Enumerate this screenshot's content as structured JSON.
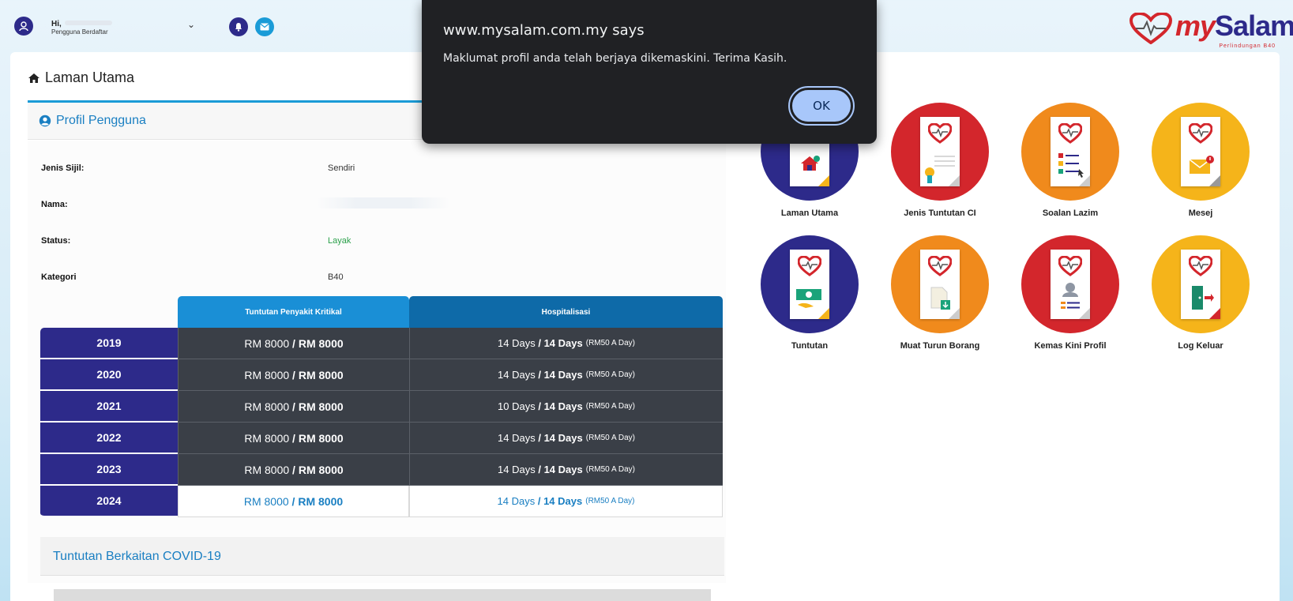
{
  "header": {
    "greeting": "Hi,",
    "user_role": "Pengguna Berdaftar",
    "logo": {
      "my": "my",
      "salam": "Salam",
      "tagline": "Perlindungan B40"
    }
  },
  "page_title": "Laman Utama",
  "profile": {
    "section_title": "Profil Pengguna",
    "fields": [
      {
        "label": "Jenis Sijil:",
        "value": "Sendiri"
      },
      {
        "label": "Nama:",
        "value": ""
      },
      {
        "label": "Status:",
        "value": "Layak"
      },
      {
        "label": "Kategori",
        "value": "B40"
      }
    ]
  },
  "claims_table": {
    "headers": {
      "ci": "Tuntutan Penyakit Kritikal",
      "hosp": "Hospitalisasi"
    },
    "rows": [
      {
        "year": "2019",
        "ci_used": "RM 8000",
        "ci_limit": "RM 8000",
        "hosp_used": "14 Days",
        "hosp_limit": "14 Days",
        "hosp_rate": "(RM50 A Day)"
      },
      {
        "year": "2020",
        "ci_used": "RM 8000",
        "ci_limit": "RM 8000",
        "hosp_used": "14 Days",
        "hosp_limit": "14 Days",
        "hosp_rate": "(RM50 A Day)"
      },
      {
        "year": "2021",
        "ci_used": "RM 8000",
        "ci_limit": "RM 8000",
        "hosp_used": "10 Days",
        "hosp_limit": "14 Days",
        "hosp_rate": "(RM50 A Day)"
      },
      {
        "year": "2022",
        "ci_used": "RM 8000",
        "ci_limit": "RM 8000",
        "hosp_used": "14 Days",
        "hosp_limit": "14 Days",
        "hosp_rate": "(RM50 A Day)"
      },
      {
        "year": "2023",
        "ci_used": "RM 8000",
        "ci_limit": "RM 8000",
        "hosp_used": "14 Days",
        "hosp_limit": "14 Days",
        "hosp_rate": "(RM50 A Day)"
      },
      {
        "year": "2024",
        "ci_used": "RM 8000",
        "ci_limit": "RM 8000",
        "hosp_used": "14 Days",
        "hosp_limit": "14 Days",
        "hosp_rate": "(RM50 A Day)"
      }
    ]
  },
  "covid_section_title": "Tuntutan Berkaitan COVID-19",
  "menu": [
    {
      "label": "Laman Utama",
      "icon": "home-document-icon",
      "color": "#2d2a8a"
    },
    {
      "label": "Jenis Tuntutan CI",
      "icon": "certificate-document-icon",
      "color": "#d3262c"
    },
    {
      "label": "Soalan Lazim",
      "icon": "faq-document-icon",
      "color": "#f08a1c"
    },
    {
      "label": "Mesej",
      "icon": "message-document-icon",
      "color": "#f5b41a"
    },
    {
      "label": "Tuntutan",
      "icon": "money-document-icon",
      "color": "#2d2a8a"
    },
    {
      "label": "Muat Turun Borang",
      "icon": "download-document-icon",
      "color": "#f08a1c"
    },
    {
      "label": "Kemas Kini Profil",
      "icon": "profile-document-icon",
      "color": "#d3262c"
    },
    {
      "label": "Log Keluar",
      "icon": "logout-document-icon",
      "color": "#f5b41a"
    }
  ],
  "dialog": {
    "title": "www.mysalam.com.my says",
    "message": "Maklumat profil anda telah berjaya dikemaskini. Terima Kasih.",
    "ok_label": "OK"
  }
}
